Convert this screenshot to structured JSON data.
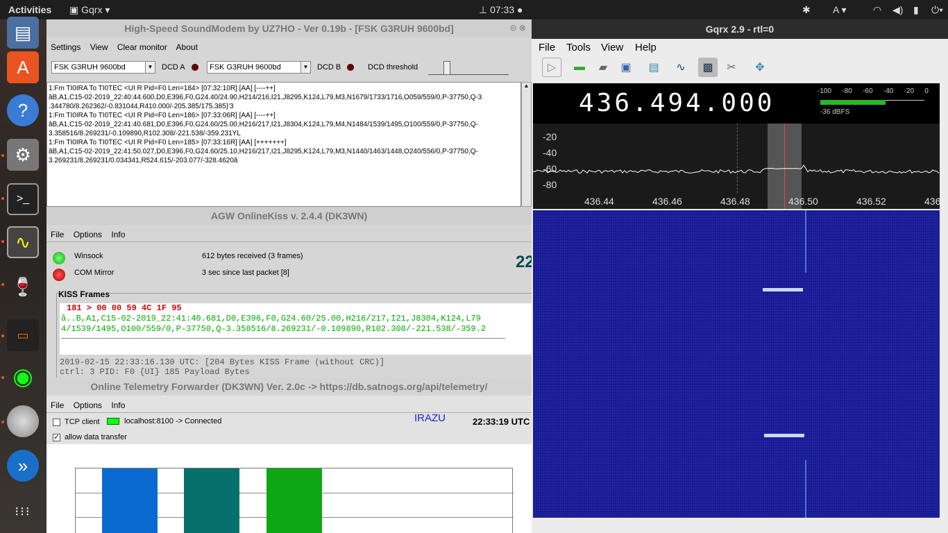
{
  "topbar": {
    "activities": "Activities",
    "app_name": "Gqrx",
    "time": "07:33",
    "keyboard": "A"
  },
  "soundmodem": {
    "title": "High-Speed SoundModem by UZ7HO - Ver 0.19b - [FSK G3RUH 9600bd]",
    "menu": [
      "Settings",
      "View",
      "Clear monitor",
      "About"
    ],
    "modem_a": "FSK G3RUH 9600bd",
    "dcd_a": "DCD A",
    "modem_b": "FSK G3RUH 9600bd",
    "dcd_b": "DCD B",
    "dcd_threshold": "DCD threshold",
    "log": [
      "1:Fm TI0IRA To TI0TEC <UI R Pid=F0 Len=184> [07:32:10R] [AA] [----++]",
      "âB,A1,C15-02-2019_22:40:44.600,D0,E396,F0,G24.40/24.90,H214/216,I21,J8295,K124,L79,M3,N1679/1733/1716,O059/559/0,P-37750,Q-3",
      ".344780/8.262362/-0.831044,R410.000/-205.385/175.385}'3",
      "1:Fm TI0IRA To TI0TEC <UI R Pid=F0 Len=186> [07:33:06R] [AA] [----++]",
      "âB,A1,C15-02-2019_22:41:40.681,D0,E396,F0,G24.60/25.00,H216/217,I21,J8304,K124,L79,M4,N1484/1539/1495,O100/559/0,P-37750,Q-",
      "3.358516/8.269231/-0.109890,R102.308/-221.538/-359.231YL",
      "1:Fm TI0IRA To TI0TEC <UI R Pid=F0 Len=185> [07:33:16R] [AA] [+++++++]",
      "âB,A1,C15-02-2019_22:41:50.027,D0,E396,F0,G24.60/25.10,H216/217,I21,J8295,K124,L79,M3,N1440/1463/1448,O240/556/0,P-37750,Q-",
      "3.269231/8.269231/0.034341,R524.615/-203.077/-328.4620â"
    ]
  },
  "onlinekiss": {
    "title": "AGW OnlineKiss v. 2.4.4  (DK3WN)",
    "menu": [
      "File",
      "Options",
      "Info"
    ],
    "winsock": "Winsock",
    "winsock_status": "612 bytes received (3 frames)",
    "com": "COM Mirror",
    "com_status": "3 sec since last packet [8]",
    "big": "22",
    "kiss_label": "KISS Frames",
    "hex": "181 > 00 00 59 4C 1F 95",
    "frame1": "â..B,A1,C15-02-2019_22:41:40.681,D0,E396,F0,G24.60/25.00,H216/217,I21,J8304,K124,L79",
    "frame2": "4/1539/1495,O100/559/0,P-37750,Q-3.358516/8.269231/-0.109890,R102.308/-221.538/-359.2",
    "info1": "2019-02-15 22:33:16.130 UTC: [204 Bytes KISS Frame (without CRC)]",
    "info2": "ctrl: 3   PID: F0 {UI}   185 Payload Bytes"
  },
  "forwarder": {
    "title": "Online Telemetry Forwarder (DK3WN) Ver. 2.0c -> https://db.satnogs.org/api/telemetry/",
    "menu": [
      "File",
      "Options",
      "Info"
    ],
    "tcp": "TCP client",
    "conn": "localhost:8100 -> Connected",
    "allow": "allow data transfer",
    "sat": "IRAZU",
    "time": "22:33:19 UTC",
    "bars": [
      {
        "color": "#0a6ad0"
      },
      {
        "color": "#06706a"
      },
      {
        "color": "#0ea614"
      }
    ]
  },
  "gqrx": {
    "title": "Gqrx 2.9 - rtl=0",
    "menu": [
      "File",
      "Tools",
      "View",
      "Help"
    ],
    "freq": "436.494.000",
    "meter_ticks": [
      "-100",
      "-80",
      "-60",
      "-40",
      "-20",
      "0"
    ],
    "meter_level": "-36 dBFS",
    "db_labels": [
      "-20",
      "-40",
      "-60",
      "-80"
    ],
    "freq_labels": [
      "436.44",
      "436.46",
      "436.48",
      "436.50",
      "436.52",
      "436"
    ]
  }
}
